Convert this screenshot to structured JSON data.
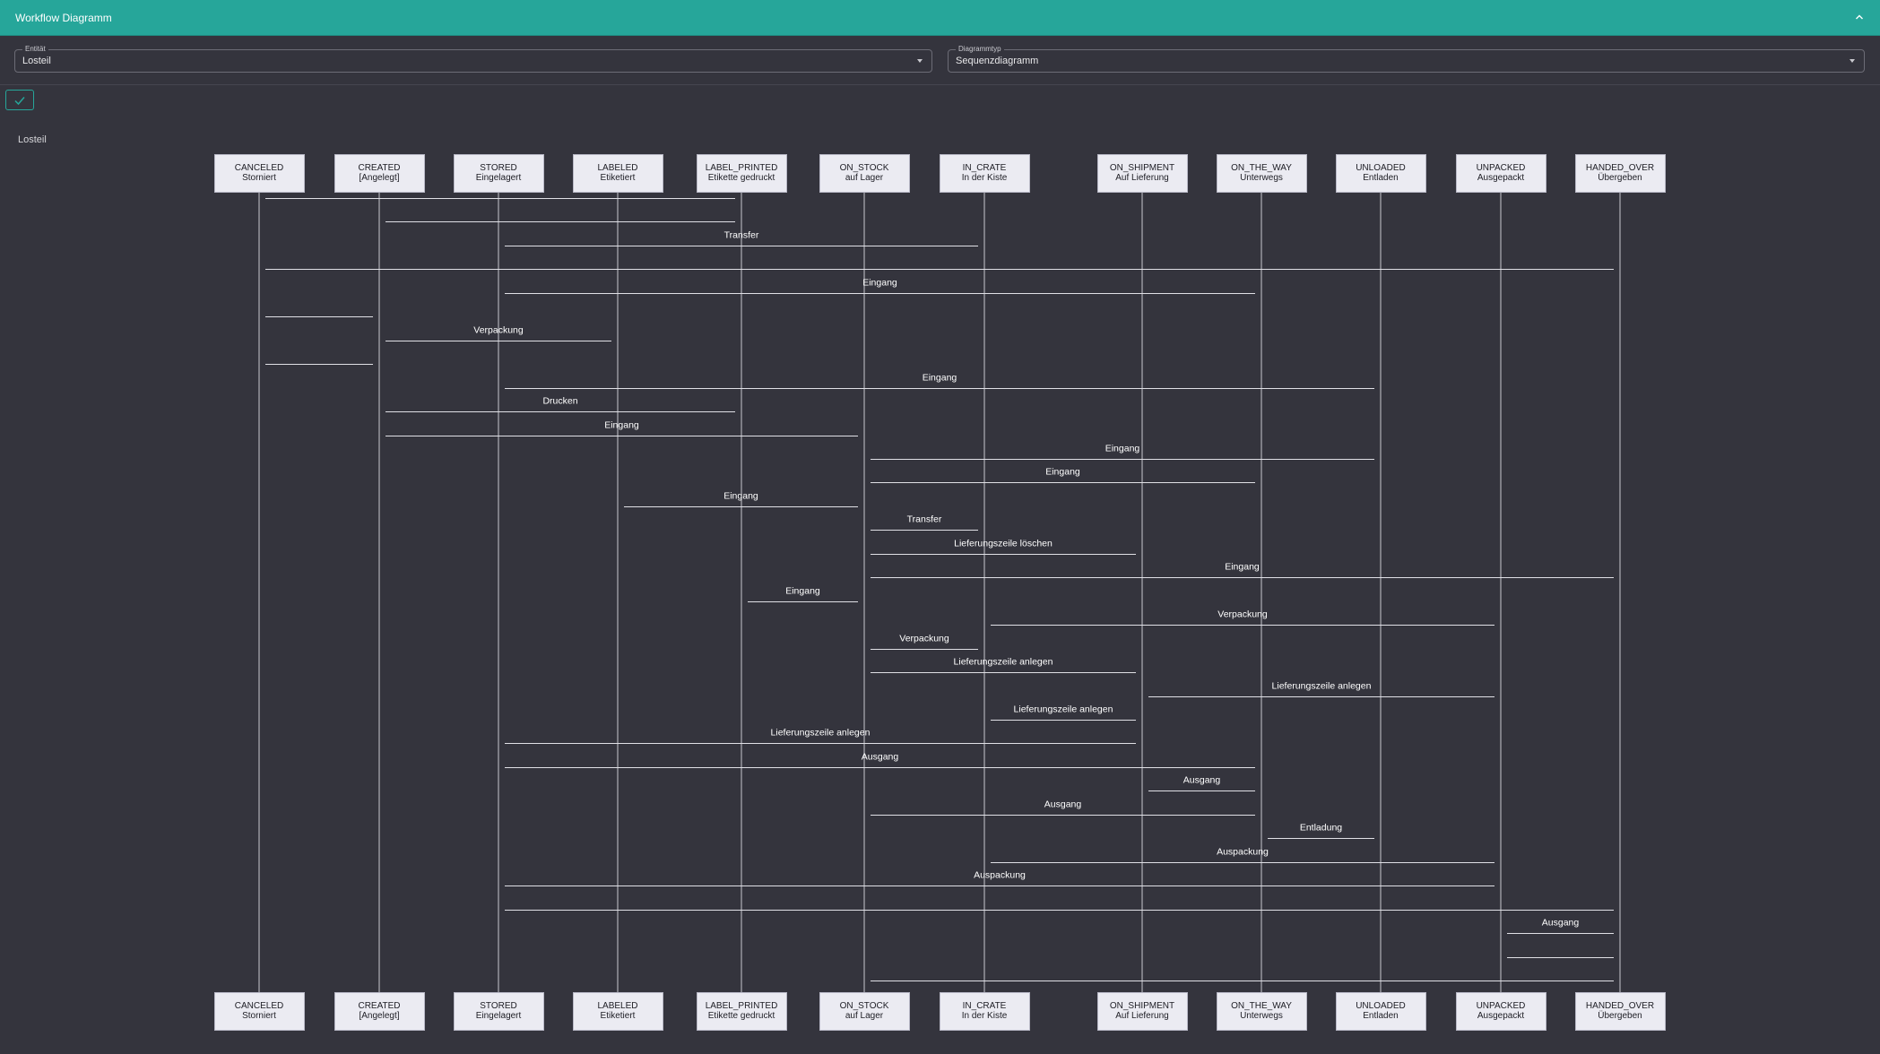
{
  "header": {
    "title": "Workflow Diagramm"
  },
  "controls": {
    "entity": {
      "label": "Entität",
      "value": "Losteil"
    },
    "diagram_type": {
      "label": "Diagrammtyp",
      "value": "Sequenzdiagramm"
    }
  },
  "diagram": {
    "caption": "Losteil",
    "actors": [
      {
        "id": "CANCELED",
        "line1": "CANCELED",
        "line2": "Storniert"
      },
      {
        "id": "CREATED",
        "line1": "CREATED",
        "line2": "[Angelegt]"
      },
      {
        "id": "STORED",
        "line1": "STORED",
        "line2": "Eingelagert"
      },
      {
        "id": "LABELED",
        "line1": "LABELED",
        "line2": "Etiketiert"
      },
      {
        "id": "LABEL_PRINTED",
        "line1": "LABEL_PRINTED",
        "line2": "Etikette gedruckt"
      },
      {
        "id": "ON_STOCK",
        "line1": "ON_STOCK",
        "line2": "auf Lager"
      },
      {
        "id": "IN_CRATE",
        "line1": "IN_CRATE",
        "line2": "In der Kiste"
      },
      {
        "id": "ON_SHIPMENT",
        "line1": "ON_SHIPMENT",
        "line2": "Auf Lieferung"
      },
      {
        "id": "ON_THE_WAY",
        "line1": "ON_THE_WAY",
        "line2": "Unterwegs"
      },
      {
        "id": "UNLOADED",
        "line1": "UNLOADED",
        "line2": "Entladen"
      },
      {
        "id": "UNPACKED",
        "line1": "UNPACKED",
        "line2": "Ausgepackt"
      },
      {
        "id": "HANDED_OVER",
        "line1": "HANDED_OVER",
        "line2": "Übergeben"
      }
    ],
    "messages": [
      {
        "from": "CANCELED",
        "to": "LABEL_PRINTED",
        "label": ""
      },
      {
        "from": "CREATED",
        "to": "LABEL_PRINTED",
        "label": ""
      },
      {
        "from": "STORED",
        "to": "IN_CRATE",
        "label": "Transfer"
      },
      {
        "from": "CANCELED",
        "to": "HANDED_OVER",
        "label": ""
      },
      {
        "from": "STORED",
        "to": "ON_THE_WAY",
        "label": "Eingang"
      },
      {
        "from": "CANCELED",
        "to": "CREATED",
        "label": ""
      },
      {
        "from": "CREATED",
        "to": "LABELED",
        "label": "Verpackung"
      },
      {
        "from": "CANCELED",
        "to": "CREATED",
        "label": ""
      },
      {
        "from": "STORED",
        "to": "UNLOADED",
        "label": "Eingang"
      },
      {
        "from": "CREATED",
        "to": "LABEL_PRINTED",
        "label": "Drucken"
      },
      {
        "from": "CREATED",
        "to": "ON_STOCK",
        "label": "Eingang"
      },
      {
        "from": "ON_STOCK",
        "to": "UNLOADED",
        "label": "Eingang"
      },
      {
        "from": "ON_STOCK",
        "to": "ON_THE_WAY",
        "label": "Eingang"
      },
      {
        "from": "LABELED",
        "to": "ON_STOCK",
        "label": "Eingang"
      },
      {
        "from": "ON_STOCK",
        "to": "IN_CRATE",
        "label": "Transfer"
      },
      {
        "from": "ON_STOCK",
        "to": "ON_SHIPMENT",
        "label": "Lieferungszeile löschen"
      },
      {
        "from": "ON_STOCK",
        "to": "HANDED_OVER",
        "label": "Eingang"
      },
      {
        "from": "LABEL_PRINTED",
        "to": "ON_STOCK",
        "label": "Eingang"
      },
      {
        "from": "IN_CRATE",
        "to": "UNPACKED",
        "label": "Verpackung"
      },
      {
        "from": "ON_STOCK",
        "to": "IN_CRATE",
        "label": "Verpackung"
      },
      {
        "from": "ON_STOCK",
        "to": "ON_SHIPMENT",
        "label": "Lieferungszeile anlegen"
      },
      {
        "from": "ON_SHIPMENT",
        "to": "UNPACKED",
        "label": "Lieferungszeile anlegen"
      },
      {
        "from": "IN_CRATE",
        "to": "ON_SHIPMENT",
        "label": "Lieferungszeile anlegen"
      },
      {
        "from": "STORED",
        "to": "ON_SHIPMENT",
        "label": "Lieferungszeile anlegen"
      },
      {
        "from": "STORED",
        "to": "ON_THE_WAY",
        "label": "Ausgang"
      },
      {
        "from": "ON_SHIPMENT",
        "to": "ON_THE_WAY",
        "label": "Ausgang"
      },
      {
        "from": "ON_STOCK",
        "to": "ON_THE_WAY",
        "label": "Ausgang"
      },
      {
        "from": "ON_THE_WAY",
        "to": "UNLOADED",
        "label": "Entladung"
      },
      {
        "from": "IN_CRATE",
        "to": "UNPACKED",
        "label": "Auspackung"
      },
      {
        "from": "STORED",
        "to": "UNPACKED",
        "label": "Auspackung"
      },
      {
        "from": "STORED",
        "to": "HANDED_OVER",
        "label": ""
      },
      {
        "from": "UNPACKED",
        "to": "HANDED_OVER",
        "label": "Ausgang"
      },
      {
        "from": "UNPACKED",
        "to": "HANDED_OVER",
        "label": ""
      },
      {
        "from": "ON_STOCK",
        "to": "HANDED_OVER",
        "label": ""
      }
    ]
  }
}
